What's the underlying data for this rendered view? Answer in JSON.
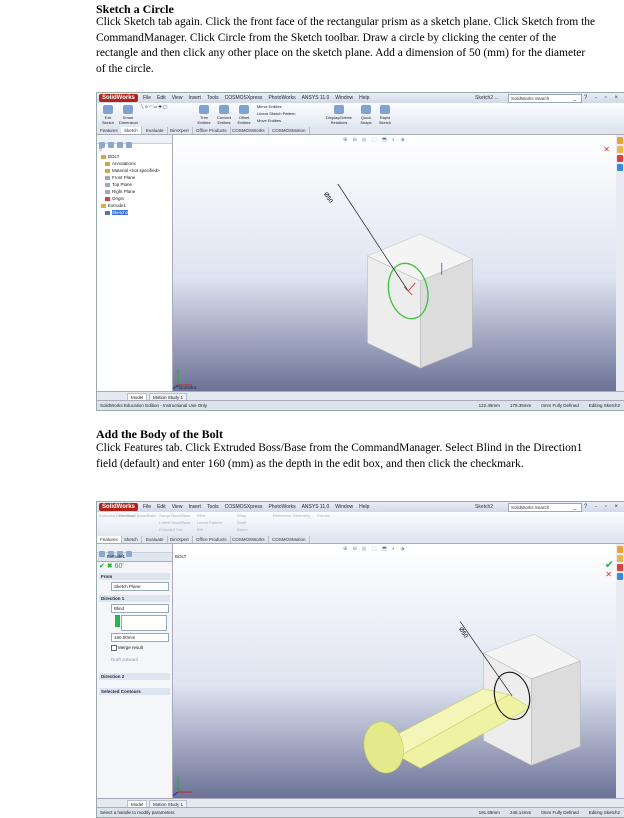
{
  "section1": {
    "heading": "Sketch a Circle",
    "paragraph": "Click Sketch tab again. Click the front face of the rectangular prism as a sketch plane. Click Sketch from the CommandManager. Click Circle from the Sketch toolbar. Draw a circle by clicking the center of the rectangle and then click any other place on the sketch plane. Add a dimension of 50 (mm) for the diameter of the circle."
  },
  "section2": {
    "heading": "Add the Body of the Bolt",
    "paragraph": "Click Features tab. Click Extruded Boss/Base from the CommandManager. Select Blind in the Direction1 field (default) and enter 160 (mm) as the depth in the edit box, and then click the checkmark."
  },
  "app": {
    "logo": "SolidWorks",
    "menu": [
      "File",
      "Edit",
      "View",
      "Insert",
      "Tools",
      "COSMOSXpress",
      "PhotoWorks",
      "ANSYS 11.0",
      "Window",
      "Help"
    ],
    "search_placeholder": "SolidWorks Search",
    "window_controls": "_ ? - ▫ ×",
    "dim_label": "Ø50",
    "model_tab": "Model",
    "motion_tab": "Motion Study 1",
    "triad_label": "*Isometric"
  },
  "shot1": {
    "doc_title": "Sketch2 ...",
    "ribbon_buttons": [
      "Exit Sketch",
      "Smart Dimension",
      "Trim Entities",
      "Convert Entities",
      "Offset Entities",
      "Display/Delete Relations",
      "Quick Snaps",
      "Rapid Sketch"
    ],
    "ribbon_small": [
      "Mirror Entities",
      "Linear Sketch Pattern",
      "Move Entities"
    ],
    "tabs": [
      "Features",
      "Sketch",
      "Evaluate",
      "DimXpert",
      "Office Products",
      "COSMOSWorks",
      "COSMOSMotion"
    ],
    "tree": [
      "BOLT",
      "Annotations",
      "Material <not specified>",
      "Front Plane",
      "Top Plane",
      "Right Plane",
      "Origin",
      "Extrude1",
      "Sketch2"
    ],
    "status_left": "SolidWorks Education Edition - Instructional Use Only",
    "status_right": [
      "122.45mm",
      "179.35mm",
      "0mm Fully Defined",
      "Editing Sketch2"
    ]
  },
  "shot2": {
    "doc_title": "Sketch2",
    "ribbon_buttons": [
      "Extruded Boss/Base",
      "Revolved Boss/Base",
      "Swept Boss/Base",
      "Lofted Boss/Base",
      "Extruded Cut",
      "Fillet",
      "Linear Pattern",
      "Rib",
      "Wrap",
      "Draft",
      "Dome",
      "Reference Geometry",
      "Curves"
    ],
    "tabs": [
      "Features",
      "Sketch",
      "Evaluate",
      "DimXpert",
      "Office Products",
      "COSMOSWorks",
      "COSMOSMotion"
    ],
    "tree_root": "BOLT",
    "pm_title": "Extrude1",
    "pm_actions": "✔ ✖ 60'",
    "from_label": "From",
    "from_value": "Sketch Plane",
    "direction_label": "Direction 1",
    "direction_value": "Blind",
    "depth_value": "160.00mm",
    "merge_label": "Merge result",
    "draft_label": "Draft outward",
    "direction2_label": "Direction 2",
    "contours_label": "Selected Contours",
    "status_left": "Select a handle to modify parameters",
    "status_right": [
      "191.69mm",
      "248.14mm",
      "0mm Fully Defined",
      "Editing Sketch2"
    ]
  }
}
